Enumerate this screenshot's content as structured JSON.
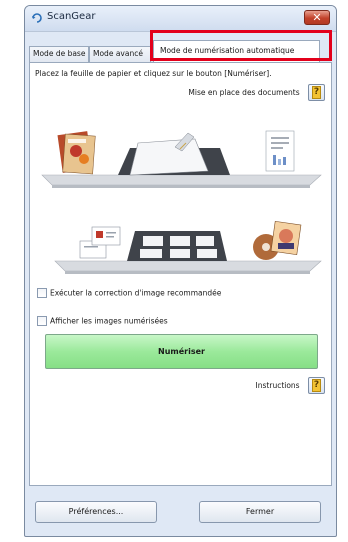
{
  "window": {
    "title": "ScanGear",
    "close_label": "✕"
  },
  "tabs": [
    {
      "label": "Mode de base"
    },
    {
      "label": "Mode avancé"
    },
    {
      "label": "Mode de numérisation automatique",
      "active": true
    }
  ],
  "panel": {
    "instruction": "Placez la feuille de papier et cliquez sur le bouton [Numériser].",
    "document_placement_label": "Mise en place des documents",
    "checkbox_correction_label": "Exécuter la correction d'image recommandée",
    "checkbox_show_label": "Afficher les images numérisées",
    "scan_button_label": "Numériser",
    "instructions_label": "Instructions",
    "help_glyph": "?"
  },
  "footer": {
    "preferences_label": "Préférences...",
    "close_label": "Fermer"
  },
  "colors": {
    "highlight": "#e3001b",
    "scan_button": "#9be99b",
    "window_bg": "#dfe8f5"
  },
  "icons": [
    "scangear-icon",
    "close-icon",
    "help-icon",
    "photo-stack-icon",
    "scanner-platen-icon",
    "document-icon",
    "cards-icon",
    "disc-photo-icon"
  ]
}
